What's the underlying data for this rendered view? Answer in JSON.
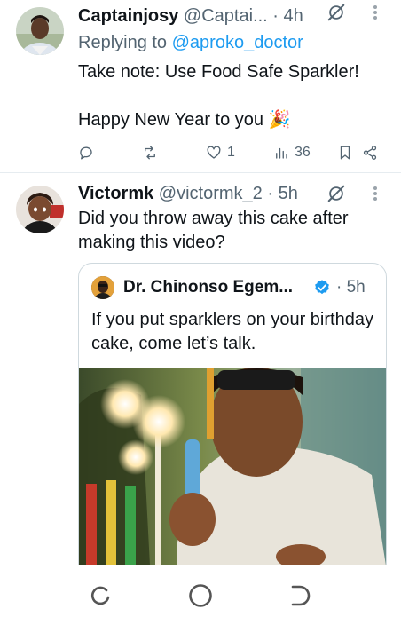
{
  "tweets": [
    {
      "name": "Captainjosy",
      "handle": "@Captai...",
      "time": "4h",
      "replying_prefix": "Replying to ",
      "replying_to": "@aproko_doctor",
      "text_line1": "Take note: Use Food Safe Sparkler!",
      "text_line2": "Happy New Year to you 🎉",
      "replies": "",
      "reposts": "",
      "likes": "1",
      "views": "36",
      "icons": [
        "grok-icon",
        "more-icon",
        "reply-icon",
        "repost-icon",
        "like-icon",
        "views-icon",
        "bookmark-icon",
        "share-icon"
      ]
    },
    {
      "name": "Victormk",
      "handle": "@victormk_2",
      "time": "5h",
      "text": "Did you throw away this cake after making this video?",
      "quote": {
        "name": "Dr. Chinonso Egem...",
        "time": "5h",
        "text": "If you put sparklers on your birthday cake, come let’s talk.",
        "verified_color": "#1d9bf0"
      }
    }
  ],
  "separator": "·",
  "colors": {
    "accent": "#1d9bf0",
    "muted": "#536471",
    "text": "#0f1419"
  },
  "nav": [
    "recents-icon",
    "home-icon",
    "back-icon"
  ]
}
